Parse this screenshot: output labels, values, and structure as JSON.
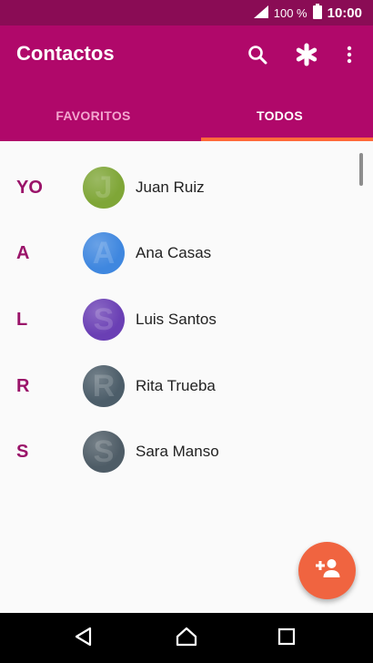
{
  "status_bar": {
    "battery_text": "100 %",
    "time": "10:00",
    "icons": [
      "signal-icon",
      "battery-icon"
    ]
  },
  "app_bar": {
    "title": "Contactos",
    "actions": [
      "search-icon",
      "asterisk-icon",
      "more-vert-icon"
    ],
    "background": "#b0086a"
  },
  "tabs": [
    {
      "label": "FAVORITOS",
      "selected": false
    },
    {
      "label": "TODOS",
      "selected": true
    }
  ],
  "contacts": [
    {
      "letter": "YO",
      "name": "Juan Ruiz",
      "avatar_color": "#7fa637",
      "avatar_glyph": "J"
    },
    {
      "letter": "A",
      "name": "Ana Casas",
      "avatar_color": "#3f87df",
      "avatar_glyph": "A"
    },
    {
      "letter": "L",
      "name": "Luis Santos",
      "avatar_color": "#6a3fb4",
      "avatar_glyph": "S"
    },
    {
      "letter": "R",
      "name": "Rita Trueba",
      "avatar_color": "#4c5d69",
      "avatar_glyph": "R"
    },
    {
      "letter": "S",
      "name": "Sara Manso",
      "avatar_color": "#4e5c66",
      "avatar_glyph": "S"
    }
  ],
  "fab": {
    "icon": "add-person-icon",
    "color": "#f06440"
  },
  "nav_bar": {
    "buttons": [
      "back-icon",
      "home-icon",
      "recents-icon"
    ]
  },
  "colors": {
    "accent": "#ff6a3a",
    "section_letter": "#9a1369",
    "status_bar": "#8a0c55"
  }
}
